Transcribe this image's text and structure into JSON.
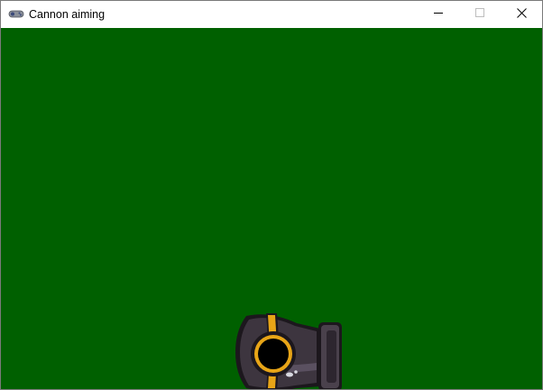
{
  "window": {
    "title": "Cannon aiming",
    "app_icon": "gamepad-icon",
    "controls": {
      "minimize_icon": "minimize-icon",
      "maximize_icon": "maximize-icon",
      "close_icon": "close-icon"
    }
  },
  "game": {
    "background_color": "#006000",
    "cannon": {
      "icon": "cannon-icon",
      "barrel_color": "#3d353f",
      "band_color": "#e8a517",
      "muzzle_ring_color": "#e8a517"
    }
  }
}
